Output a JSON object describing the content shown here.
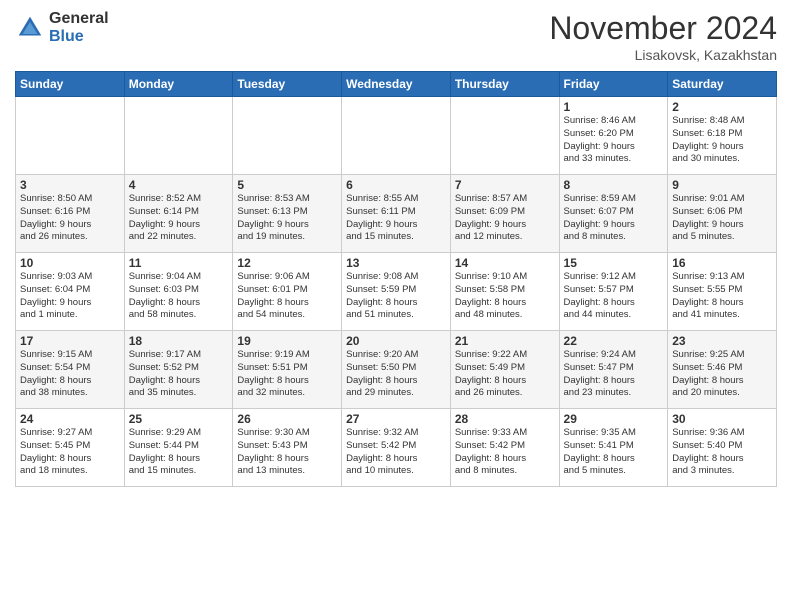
{
  "header": {
    "logo_general": "General",
    "logo_blue": "Blue",
    "month_title": "November 2024",
    "location": "Lisakovsk, Kazakhstan"
  },
  "weekdays": [
    "Sunday",
    "Monday",
    "Tuesday",
    "Wednesday",
    "Thursday",
    "Friday",
    "Saturday"
  ],
  "weeks": [
    [
      {
        "day": "",
        "info": ""
      },
      {
        "day": "",
        "info": ""
      },
      {
        "day": "",
        "info": ""
      },
      {
        "day": "",
        "info": ""
      },
      {
        "day": "",
        "info": ""
      },
      {
        "day": "1",
        "info": "Sunrise: 8:46 AM\nSunset: 6:20 PM\nDaylight: 9 hours\nand 33 minutes."
      },
      {
        "day": "2",
        "info": "Sunrise: 8:48 AM\nSunset: 6:18 PM\nDaylight: 9 hours\nand 30 minutes."
      }
    ],
    [
      {
        "day": "3",
        "info": "Sunrise: 8:50 AM\nSunset: 6:16 PM\nDaylight: 9 hours\nand 26 minutes."
      },
      {
        "day": "4",
        "info": "Sunrise: 8:52 AM\nSunset: 6:14 PM\nDaylight: 9 hours\nand 22 minutes."
      },
      {
        "day": "5",
        "info": "Sunrise: 8:53 AM\nSunset: 6:13 PM\nDaylight: 9 hours\nand 19 minutes."
      },
      {
        "day": "6",
        "info": "Sunrise: 8:55 AM\nSunset: 6:11 PM\nDaylight: 9 hours\nand 15 minutes."
      },
      {
        "day": "7",
        "info": "Sunrise: 8:57 AM\nSunset: 6:09 PM\nDaylight: 9 hours\nand 12 minutes."
      },
      {
        "day": "8",
        "info": "Sunrise: 8:59 AM\nSunset: 6:07 PM\nDaylight: 9 hours\nand 8 minutes."
      },
      {
        "day": "9",
        "info": "Sunrise: 9:01 AM\nSunset: 6:06 PM\nDaylight: 9 hours\nand 5 minutes."
      }
    ],
    [
      {
        "day": "10",
        "info": "Sunrise: 9:03 AM\nSunset: 6:04 PM\nDaylight: 9 hours\nand 1 minute."
      },
      {
        "day": "11",
        "info": "Sunrise: 9:04 AM\nSunset: 6:03 PM\nDaylight: 8 hours\nand 58 minutes."
      },
      {
        "day": "12",
        "info": "Sunrise: 9:06 AM\nSunset: 6:01 PM\nDaylight: 8 hours\nand 54 minutes."
      },
      {
        "day": "13",
        "info": "Sunrise: 9:08 AM\nSunset: 5:59 PM\nDaylight: 8 hours\nand 51 minutes."
      },
      {
        "day": "14",
        "info": "Sunrise: 9:10 AM\nSunset: 5:58 PM\nDaylight: 8 hours\nand 48 minutes."
      },
      {
        "day": "15",
        "info": "Sunrise: 9:12 AM\nSunset: 5:57 PM\nDaylight: 8 hours\nand 44 minutes."
      },
      {
        "day": "16",
        "info": "Sunrise: 9:13 AM\nSunset: 5:55 PM\nDaylight: 8 hours\nand 41 minutes."
      }
    ],
    [
      {
        "day": "17",
        "info": "Sunrise: 9:15 AM\nSunset: 5:54 PM\nDaylight: 8 hours\nand 38 minutes."
      },
      {
        "day": "18",
        "info": "Sunrise: 9:17 AM\nSunset: 5:52 PM\nDaylight: 8 hours\nand 35 minutes."
      },
      {
        "day": "19",
        "info": "Sunrise: 9:19 AM\nSunset: 5:51 PM\nDaylight: 8 hours\nand 32 minutes."
      },
      {
        "day": "20",
        "info": "Sunrise: 9:20 AM\nSunset: 5:50 PM\nDaylight: 8 hours\nand 29 minutes."
      },
      {
        "day": "21",
        "info": "Sunrise: 9:22 AM\nSunset: 5:49 PM\nDaylight: 8 hours\nand 26 minutes."
      },
      {
        "day": "22",
        "info": "Sunrise: 9:24 AM\nSunset: 5:47 PM\nDaylight: 8 hours\nand 23 minutes."
      },
      {
        "day": "23",
        "info": "Sunrise: 9:25 AM\nSunset: 5:46 PM\nDaylight: 8 hours\nand 20 minutes."
      }
    ],
    [
      {
        "day": "24",
        "info": "Sunrise: 9:27 AM\nSunset: 5:45 PM\nDaylight: 8 hours\nand 18 minutes."
      },
      {
        "day": "25",
        "info": "Sunrise: 9:29 AM\nSunset: 5:44 PM\nDaylight: 8 hours\nand 15 minutes."
      },
      {
        "day": "26",
        "info": "Sunrise: 9:30 AM\nSunset: 5:43 PM\nDaylight: 8 hours\nand 13 minutes."
      },
      {
        "day": "27",
        "info": "Sunrise: 9:32 AM\nSunset: 5:42 PM\nDaylight: 8 hours\nand 10 minutes."
      },
      {
        "day": "28",
        "info": "Sunrise: 9:33 AM\nSunset: 5:42 PM\nDaylight: 8 hours\nand 8 minutes."
      },
      {
        "day": "29",
        "info": "Sunrise: 9:35 AM\nSunset: 5:41 PM\nDaylight: 8 hours\nand 5 minutes."
      },
      {
        "day": "30",
        "info": "Sunrise: 9:36 AM\nSunset: 5:40 PM\nDaylight: 8 hours\nand 3 minutes."
      }
    ]
  ]
}
